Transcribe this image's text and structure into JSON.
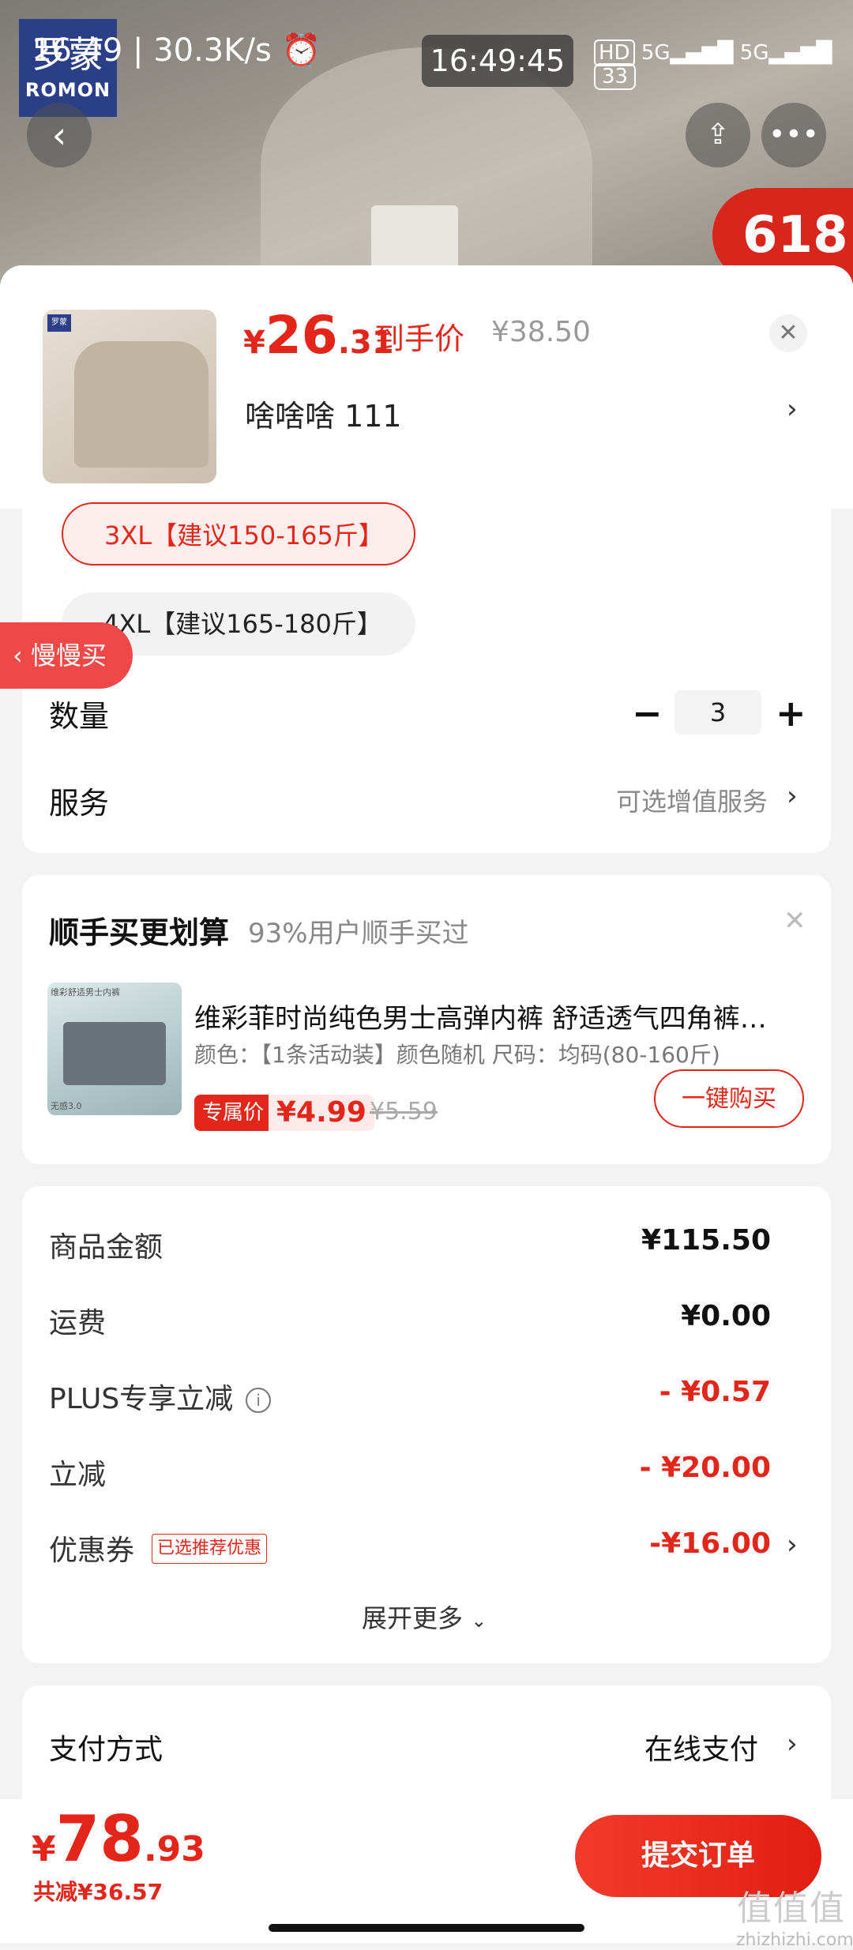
{
  "status_bar": {
    "time": "16:49",
    "speed": "30.3K/s",
    "clock_pill": "16:49:45",
    "hd": "HD",
    "signal_1": "5G",
    "signal_2": "5G",
    "battery": "33"
  },
  "brand_logo": {
    "cn": "罗蒙",
    "en": "ROMON"
  },
  "promo_badge": "618",
  "product": {
    "price_yen": "¥",
    "price_int": "26",
    "price_dec": ".31",
    "price_label": "到手价",
    "original_price": "¥38.50",
    "variant": "啥啥啥  111",
    "thumb_logo": "罗蒙"
  },
  "sizes": [
    {
      "label": "3XL【建议150-165斤】",
      "selected": true
    },
    {
      "label": "4XL【建议165-180斤】",
      "selected": false
    }
  ],
  "slow_buy": "慢慢买",
  "quantity": {
    "label": "数量",
    "minus": "−",
    "value": "3",
    "plus": "+"
  },
  "service": {
    "label": "服务",
    "value": "可选增值服务"
  },
  "combo": {
    "title": "顺手买更划算",
    "subtitle": "93%用户顺手买过",
    "item_name": "维彩菲时尚纯色男士高弹内裤 舒适透气四角裤…",
    "item_spec": "颜色：【1条活动装】颜色随机   尺码：均码(80-160斤)",
    "badge": "专属价",
    "price": "¥4.99",
    "old_price": "¥5.59",
    "buy_button": "一键购买",
    "img_brand": "维彩舒适男士内裤",
    "img_foot": "无感3.0"
  },
  "summary": {
    "rows": [
      {
        "label": "商品金额",
        "value": "¥115.50"
      },
      {
        "label": "运费",
        "value": "¥0.00"
      },
      {
        "label": "PLUS专享立减",
        "value": "- ¥0.57"
      },
      {
        "label": "立减",
        "value": "- ¥20.00"
      },
      {
        "label": "优惠券",
        "value": "-¥16.00"
      }
    ],
    "coupon_badge": "已选推荐优惠",
    "expand": "展开更多"
  },
  "payment": {
    "label": "支付方式",
    "value": "在线支付"
  },
  "footer": {
    "total_yen": "¥",
    "total_int": "78",
    "total_dec": ".93",
    "saved": "共减¥36.57",
    "submit": "提交订单"
  },
  "watermark": {
    "logo": "值值值",
    "url": "zhizhizhi.com"
  },
  "colors": {
    "accent": "#e4261a",
    "background": "#f3f3f3"
  }
}
